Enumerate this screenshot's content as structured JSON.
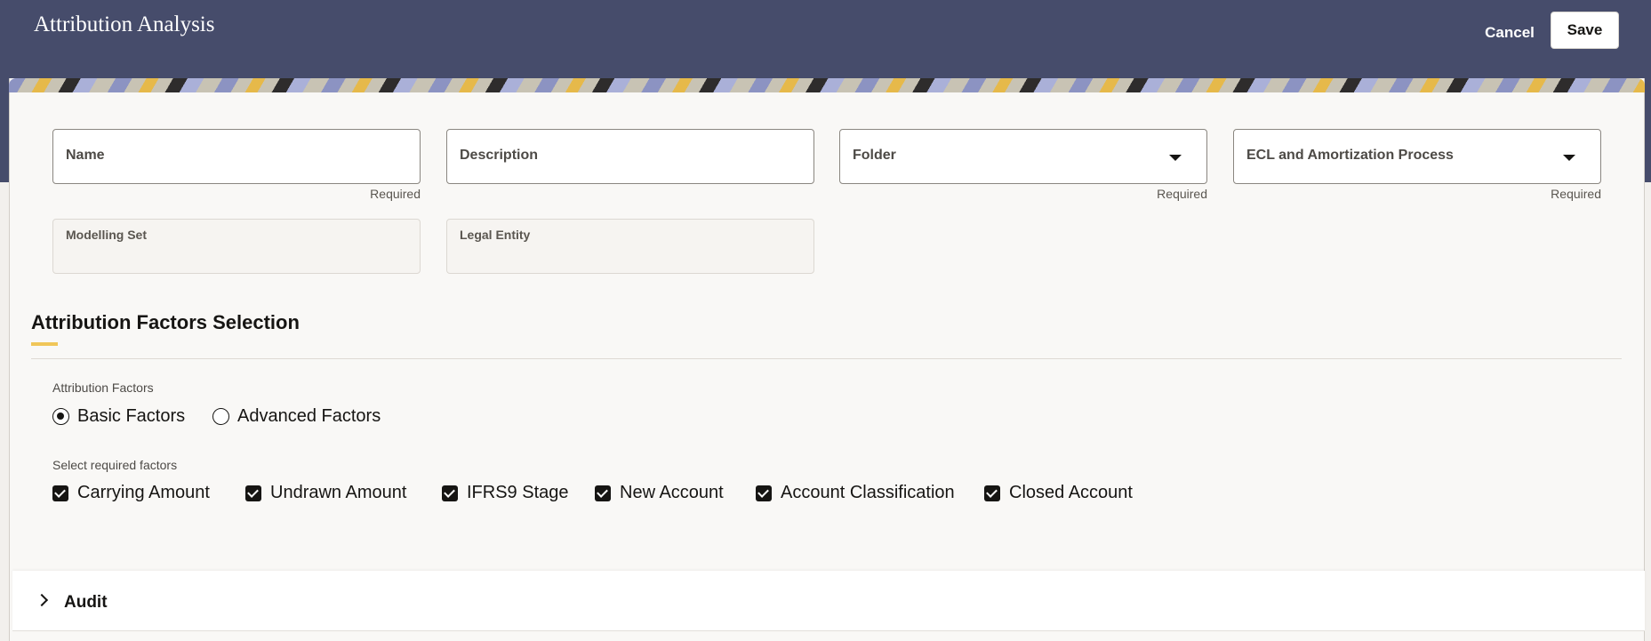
{
  "header": {
    "title": "Attribution Analysis",
    "cancel_label": "Cancel",
    "save_label": "Save"
  },
  "form": {
    "name": {
      "placeholder": "Name",
      "helper": "Required"
    },
    "description": {
      "placeholder": "Description"
    },
    "folder": {
      "placeholder": "Folder",
      "helper": "Required"
    },
    "process": {
      "placeholder": "ECL and Amortization Process",
      "helper": "Required"
    },
    "modelling_set": {
      "label": "Modelling Set",
      "value": ""
    },
    "legal_entity": {
      "label": "Legal Entity",
      "value": ""
    }
  },
  "factors_section": {
    "title": "Attribution Factors Selection",
    "attribution_factors_label": "Attribution Factors",
    "radio_options": [
      {
        "label": "Basic Factors",
        "selected": true
      },
      {
        "label": "Advanced Factors",
        "selected": false
      }
    ],
    "required_factors_label": "Select required factors",
    "checkboxes": [
      {
        "label": "Carrying Amount",
        "checked": true
      },
      {
        "label": "Undrawn Amount",
        "checked": true
      },
      {
        "label": "IFRS9 Stage",
        "checked": true
      },
      {
        "label": "New Account",
        "checked": true
      },
      {
        "label": "Account Classification",
        "checked": true
      },
      {
        "label": "Closed Account",
        "checked": true
      }
    ]
  },
  "audit": {
    "label": "Audit"
  },
  "colors": {
    "header_bg": "#464c6b",
    "accent": "#f0c659",
    "checkbox_fill": "#161513"
  }
}
